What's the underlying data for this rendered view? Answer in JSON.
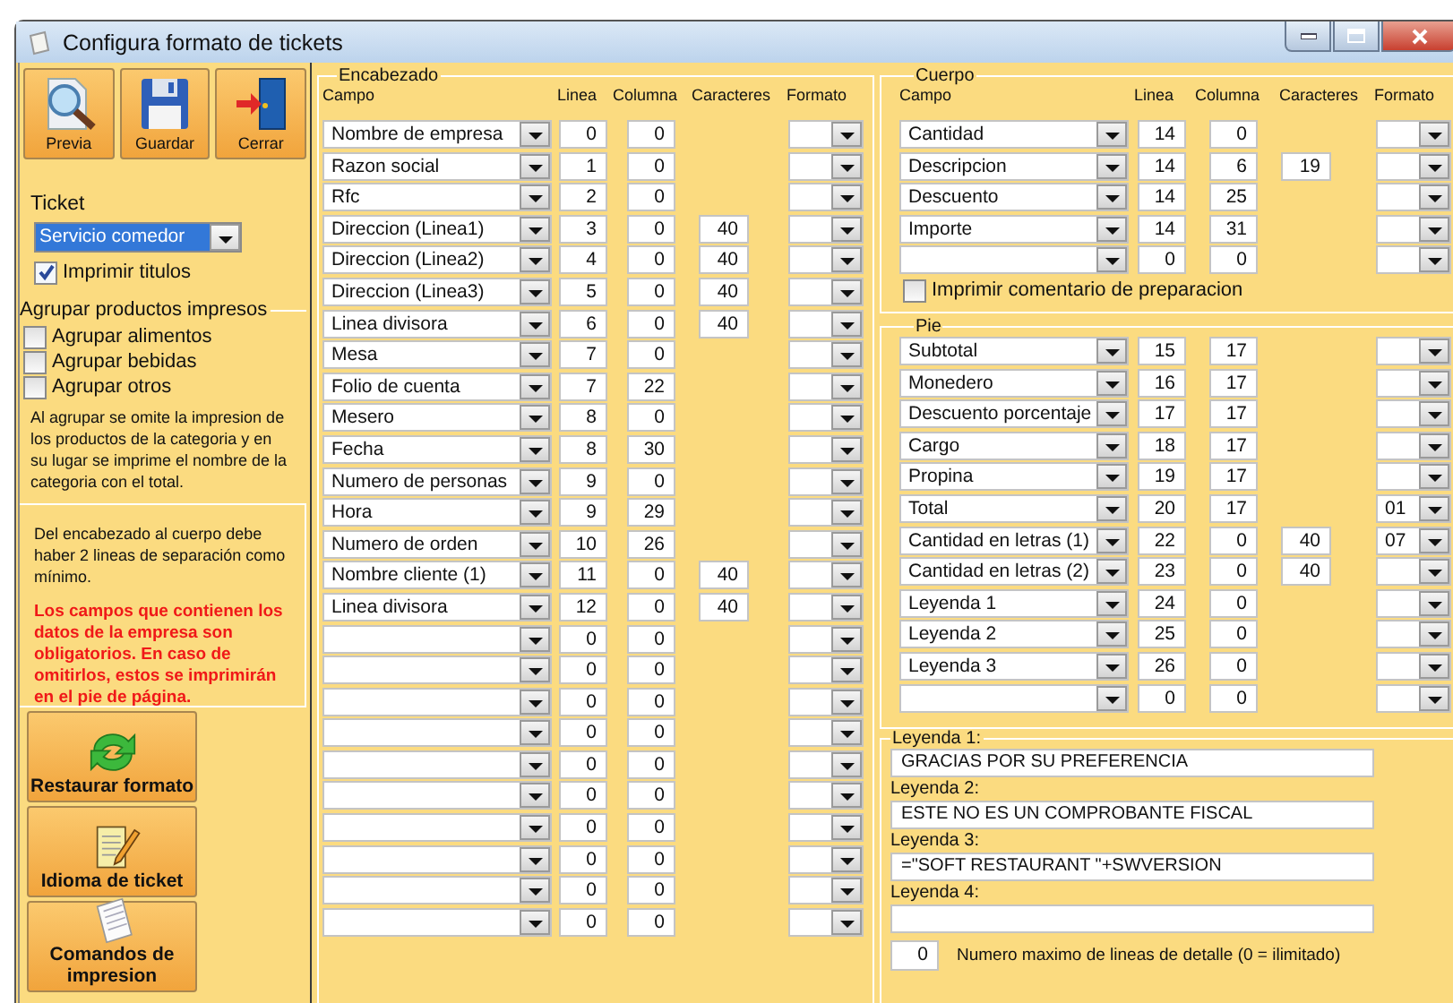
{
  "window": {
    "title": "Configura formato de tickets"
  },
  "toolbar": [
    {
      "label": "Previa",
      "kind": "preview"
    },
    {
      "label": "Guardar",
      "kind": "save"
    },
    {
      "label": "Cerrar",
      "kind": "close"
    }
  ],
  "ticket": {
    "label": "Ticket",
    "value": "Servicio comedor",
    "imprimir_titulos": {
      "label": "Imprimir titulos",
      "checked": true
    }
  },
  "agrupar": {
    "title": "Agrupar productos impresos",
    "options": [
      {
        "label": "Agrupar alimentos",
        "checked": false
      },
      {
        "label": "Agrupar bebidas",
        "checked": false
      },
      {
        "label": "Agrupar otros",
        "checked": false
      }
    ],
    "note": "Al agrupar se omite la impresion de los productos de la categoria y en su lugar se imprime el nombre de la categoria con el total."
  },
  "notes": {
    "separation": "Del encabezado al cuerpo debe haber 2 lineas de separación como mínimo.",
    "warning": "Los campos que contienen los datos de la empresa son obligatorios. En caso de omitirlos, estos se imprimirán en el pie de página."
  },
  "side_buttons": [
    {
      "label": "Restaurar formato",
      "kind": "restore"
    },
    {
      "label": "Idioma de ticket",
      "kind": "language"
    },
    {
      "label": "Comandos de impresion",
      "kind": "commands"
    }
  ],
  "encabezado": {
    "title": "Encabezado",
    "columns": [
      "Campo",
      "Linea",
      "Columna",
      "Caracteres",
      "Formato"
    ],
    "rows": [
      {
        "campo": "Nombre de empresa",
        "linea": "0",
        "columna": "0"
      },
      {
        "campo": "Razon social",
        "linea": "1",
        "columna": "0"
      },
      {
        "campo": "Rfc",
        "linea": "2",
        "columna": "0"
      },
      {
        "campo": "Direccion (Linea1)",
        "linea": "3",
        "columna": "0",
        "caracteres": "40"
      },
      {
        "campo": "Direccion (Linea2)",
        "linea": "4",
        "columna": "0",
        "caracteres": "40"
      },
      {
        "campo": "Direccion (Linea3)",
        "linea": "5",
        "columna": "0",
        "caracteres": "40"
      },
      {
        "campo": "Linea divisora",
        "linea": "6",
        "columna": "0",
        "caracteres": "40"
      },
      {
        "campo": "Mesa",
        "linea": "7",
        "columna": "0"
      },
      {
        "campo": "Folio de cuenta",
        "linea": "7",
        "columna": "22"
      },
      {
        "campo": "Mesero",
        "linea": "8",
        "columna": "0"
      },
      {
        "campo": "Fecha",
        "linea": "8",
        "columna": "30"
      },
      {
        "campo": "Numero de personas",
        "linea": "9",
        "columna": "0"
      },
      {
        "campo": "Hora",
        "linea": "9",
        "columna": "29"
      },
      {
        "campo": "Numero de orden",
        "linea": "10",
        "columna": "26"
      },
      {
        "campo": "Nombre cliente (1)",
        "linea": "11",
        "columna": "0",
        "caracteres": "40"
      },
      {
        "campo": "Linea divisora",
        "linea": "12",
        "columna": "0",
        "caracteres": "40"
      },
      {
        "linea": "0",
        "columna": "0"
      },
      {
        "linea": "0",
        "columna": "0"
      },
      {
        "linea": "0",
        "columna": "0"
      },
      {
        "linea": "0",
        "columna": "0"
      },
      {
        "linea": "0",
        "columna": "0"
      },
      {
        "linea": "0",
        "columna": "0"
      },
      {
        "linea": "0",
        "columna": "0"
      },
      {
        "linea": "0",
        "columna": "0"
      },
      {
        "linea": "0",
        "columna": "0"
      },
      {
        "linea": "0",
        "columna": "0"
      }
    ]
  },
  "cuerpo": {
    "title": "Cuerpo",
    "columns": [
      "Campo",
      "Linea",
      "Columna",
      "Caracteres",
      "Formato"
    ],
    "rows": [
      {
        "campo": "Cantidad",
        "linea": "14",
        "columna": "0"
      },
      {
        "campo": "Descripcion",
        "linea": "14",
        "columna": "6",
        "caracteres": "19"
      },
      {
        "campo": "Descuento",
        "linea": "14",
        "columna": "25"
      },
      {
        "campo": "Importe",
        "linea": "14",
        "columna": "31"
      },
      {
        "linea": "0",
        "columna": "0"
      }
    ],
    "imprimir_comentario": {
      "label": "Imprimir comentario de preparacion",
      "checked": false
    }
  },
  "pie": {
    "title": "Pie",
    "rows": [
      {
        "campo": "Subtotal",
        "linea": "15",
        "columna": "17"
      },
      {
        "campo": "Monedero",
        "linea": "16",
        "columna": "17"
      },
      {
        "campo": "Descuento porcentaje",
        "linea": "17",
        "columna": "17"
      },
      {
        "campo": "Cargo",
        "linea": "18",
        "columna": "17"
      },
      {
        "campo": "Propina",
        "linea": "19",
        "columna": "17"
      },
      {
        "campo": "Total",
        "linea": "20",
        "columna": "17",
        "formato": "01"
      },
      {
        "campo": "Cantidad en letras (1)",
        "linea": "22",
        "columna": "0",
        "caracteres": "40",
        "formato": "07"
      },
      {
        "campo": "Cantidad en letras (2)",
        "linea": "23",
        "columna": "0",
        "caracteres": "40"
      },
      {
        "campo": "Leyenda 1",
        "linea": "24",
        "columna": "0"
      },
      {
        "campo": "Leyenda 2",
        "linea": "25",
        "columna": "0"
      },
      {
        "campo": "Leyenda 3",
        "linea": "26",
        "columna": "0"
      },
      {
        "linea": "0",
        "columna": "0"
      }
    ]
  },
  "leyendas": [
    {
      "label": "Leyenda 1:",
      "value": "GRACIAS POR SU PREFERENCIA"
    },
    {
      "label": "Leyenda 2:",
      "value": "ESTE NO ES UN COMPROBANTE FISCAL"
    },
    {
      "label": "Leyenda 3:",
      "value": "=\"SOFT RESTAURANT \"+SWVERSION"
    },
    {
      "label": "Leyenda 4:"
    }
  ],
  "max_lineas": {
    "value": "0",
    "label": "Numero maximo de lineas de detalle (0 = ilimitado)"
  }
}
